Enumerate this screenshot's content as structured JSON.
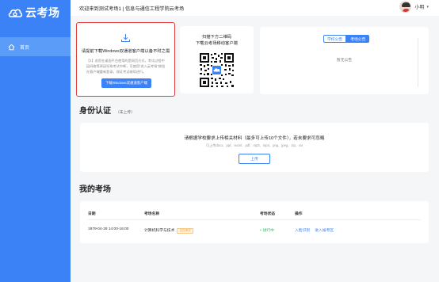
{
  "app": {
    "logo_text": "云考场"
  },
  "sidebar": {
    "items": [
      {
        "label": "首页",
        "icon": "home-icon"
      }
    ]
  },
  "topbar": {
    "title": "欢迎来到测试考场1 | 信息与通信工程学院云考场",
    "user_name": "小明"
  },
  "download": {
    "title": "请提前下载Windows双通道客户端以备不时之需",
    "desc": "【1】若您在桌面平台使用的是网页方式，考试过程中因网络等原因导致考试中断，可使用“进入云考场”按钮在客户端重新登录，保证考试继续进行。",
    "button": "下载Windows双通道客户端"
  },
  "qr": {
    "line1": "扫描下方二维码",
    "line2": "下载云考场移动客户端"
  },
  "notice": {
    "tabs": [
      "学校公告",
      "考场公告"
    ],
    "active_tab": 1,
    "empty_text": "暂无公告"
  },
  "identity": {
    "title": "身份认证",
    "status": "（未上传）",
    "main_text": "请根据学校要求上传相关材料（最多可上传10个文件），若未要求可忽略",
    "sub_text": "可上传docx、ppt、excel、pdf、mp3、mp4、png、jpeg、zip、rar",
    "upload_button": "上传"
  },
  "exams": {
    "title": "我的考场",
    "headers": {
      "date": "日期",
      "name": "考场名称",
      "status": "考场状态",
      "actions": "操作"
    },
    "rows": [
      {
        "date": "1979-04-28 14:00-16:00",
        "name": "计算机科学与技术",
        "tag": "正在考试",
        "status": "进行中",
        "action1": "入脸识别",
        "action2": "进入候考区"
      }
    ]
  },
  "colors": {
    "primary": "#3a82f6",
    "highlight_border": "#e03a3a",
    "status_green": "#33b56a"
  }
}
